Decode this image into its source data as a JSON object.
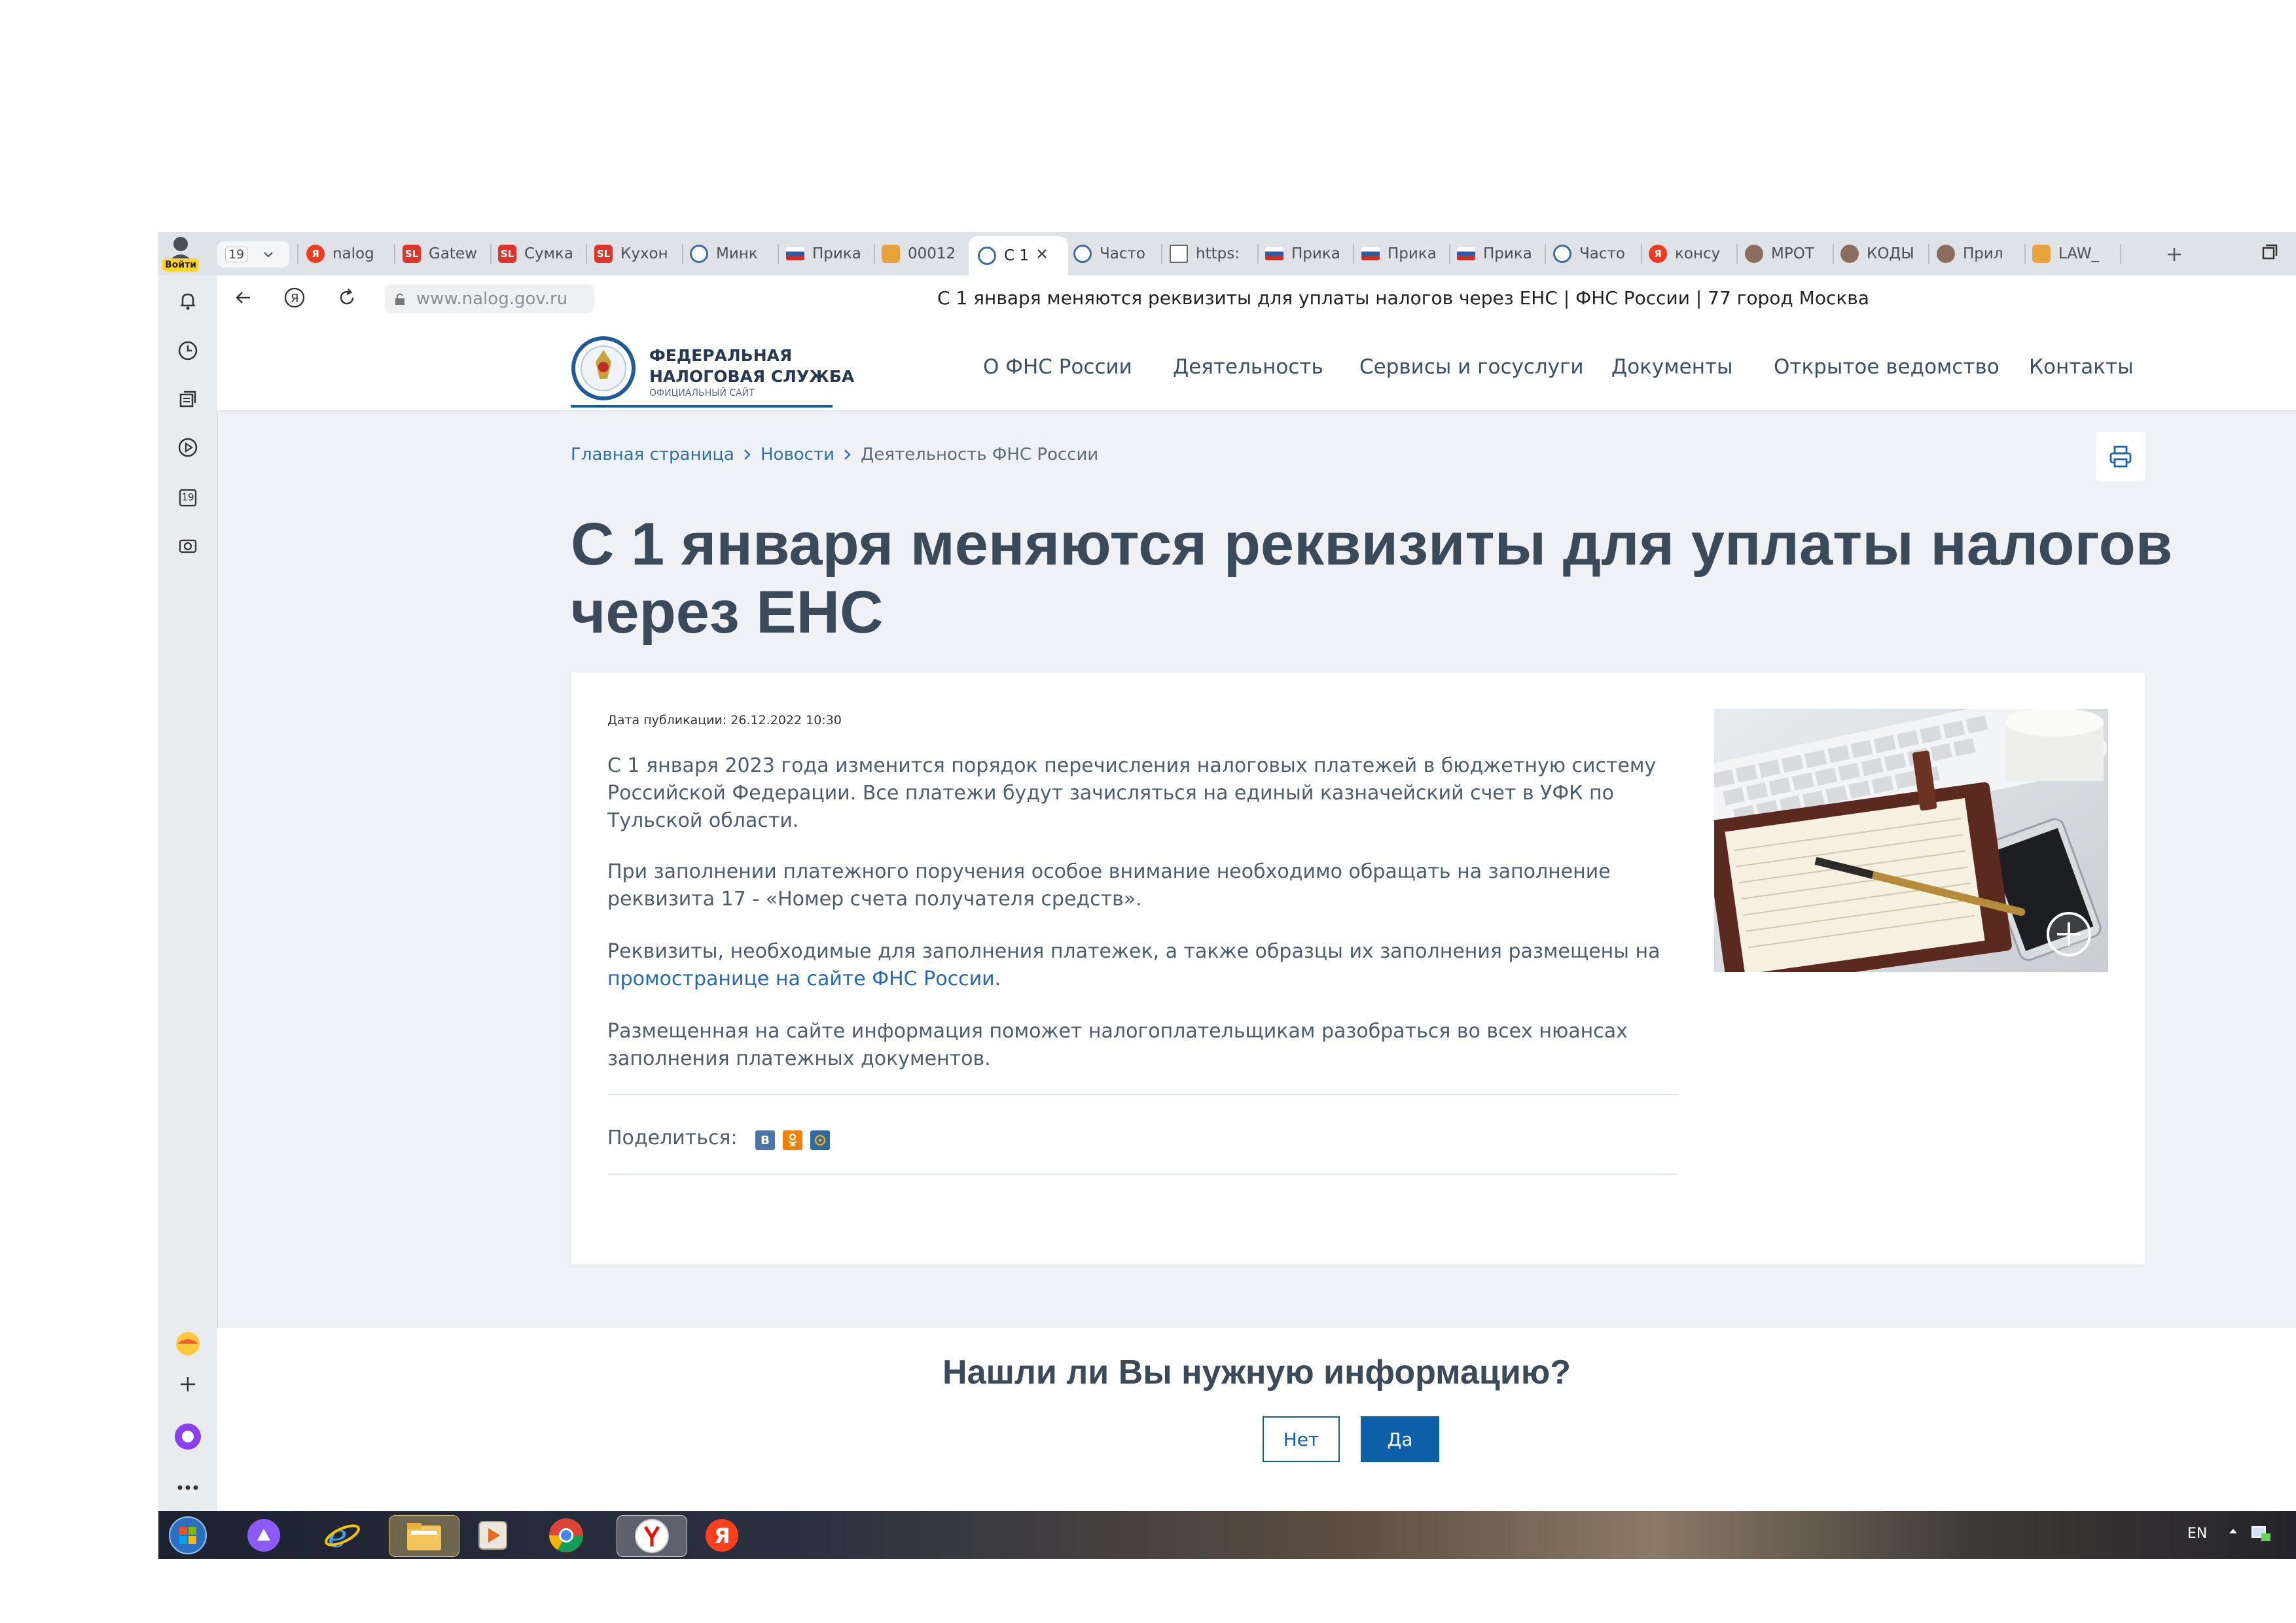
{
  "browser": {
    "profile_label": "Войти",
    "tab_counter": "19",
    "url": "www.nalog.gov.ru",
    "page_title": "С 1 января меняются реквизиты для уплаты налогов через ЕНС | ФНС России | 77 город Москва",
    "tabs": [
      {
        "label": "nalog",
        "icon": "yandex-icon",
        "color": "#f33a1f"
      },
      {
        "label": "Gatew",
        "icon": "sl-icon",
        "color": "#e0342b"
      },
      {
        "label": "Сумка",
        "icon": "sl-icon",
        "color": "#e0342b"
      },
      {
        "label": "Кухон",
        "icon": "sl-icon",
        "color": "#e0342b"
      },
      {
        "label": "Минк",
        "icon": "emblem-icon",
        "color": "#3a6ea5"
      },
      {
        "label": "Прика",
        "icon": "flag-icon",
        "color": "#d52b1e"
      },
      {
        "label": "00012",
        "icon": "doc-orange-icon",
        "color": "#e8a33a"
      },
      {
        "label": "С 1",
        "icon": "emblem-icon",
        "color": "#3a6ea5",
        "active": true
      },
      {
        "label": "Часто",
        "icon": "emblem-icon",
        "color": "#3a6ea5"
      },
      {
        "label": "https:",
        "icon": "page-icon",
        "color": "#7a7f86"
      },
      {
        "label": "Прика",
        "icon": "flag-icon",
        "color": "#d52b1e"
      },
      {
        "label": "Прика",
        "icon": "flag-icon",
        "color": "#d52b1e"
      },
      {
        "label": "Прика",
        "icon": "flag-icon",
        "color": "#d52b1e"
      },
      {
        "label": "Часто",
        "icon": "emblem-icon",
        "color": "#3a6ea5"
      },
      {
        "label": "консу",
        "icon": "yandex-icon",
        "color": "#f33a1f"
      },
      {
        "label": "МРОТ",
        "icon": "avatar-icon",
        "color": "#8a6d5a"
      },
      {
        "label": "КОДЫ",
        "icon": "avatar-icon",
        "color": "#8a6d5a"
      },
      {
        "label": "Прил",
        "icon": "avatar-icon",
        "color": "#8a6d5a"
      },
      {
        "label": "LAW_",
        "icon": "doc-orange-icon",
        "color": "#e8a33a"
      }
    ],
    "sidebar_counter": "19"
  },
  "site": {
    "logo_line1": "ФЕДЕРАЛЬНАЯ",
    "logo_line2": "НАЛОГОВАЯ СЛУЖБА",
    "logo_line3": "ОФИЦИАЛЬНЫЙ САЙТ",
    "nav": [
      "О ФНС России",
      "Деятельность",
      "Сервисы и госуслуги",
      "Документы",
      "Открытое ведомство",
      "Контакты"
    ],
    "breadcrumbs": [
      "Главная страница",
      "Новости",
      "Деятельность ФНС России"
    ],
    "headline_line1": "С 1 января меняются реквизиты для уплаты налогов",
    "headline_line2": "через ЕНС",
    "published": "Дата публикации: 26.12.2022 10:30",
    "para1": "С 1 января 2023 года изменится порядок перечисления налоговых платежей в бюджетную систему Российской Федерации. Все платежи будут зачисляться на единый казначейский счет в УФК по Тульской области.",
    "para2": "При заполнении платежного поручения особое внимание необходимо обращать на заполнение реквизита 17 - «Номер счета получателя средств».",
    "para3_text": "Реквизиты, необходимые для заполнения платежек, а также образцы их заполнения размещены на ",
    "para3_link": "промостранице на сайте ФНС России",
    "para3_end": ".",
    "para4": "Размещенная на сайте информация поможет налогоплательщикам разобраться во всех нюансах заполнения платежных документов.",
    "share_label": "Поделиться:",
    "feedback_question": "Нашли ли Вы нужную информацию?",
    "btn_no": "Нет",
    "btn_yes": "Да"
  },
  "taskbar": {
    "lang": "EN"
  },
  "colors": {
    "accent": "#0d5fa8",
    "link": "#2469b3",
    "headline": "#3a4a58"
  }
}
